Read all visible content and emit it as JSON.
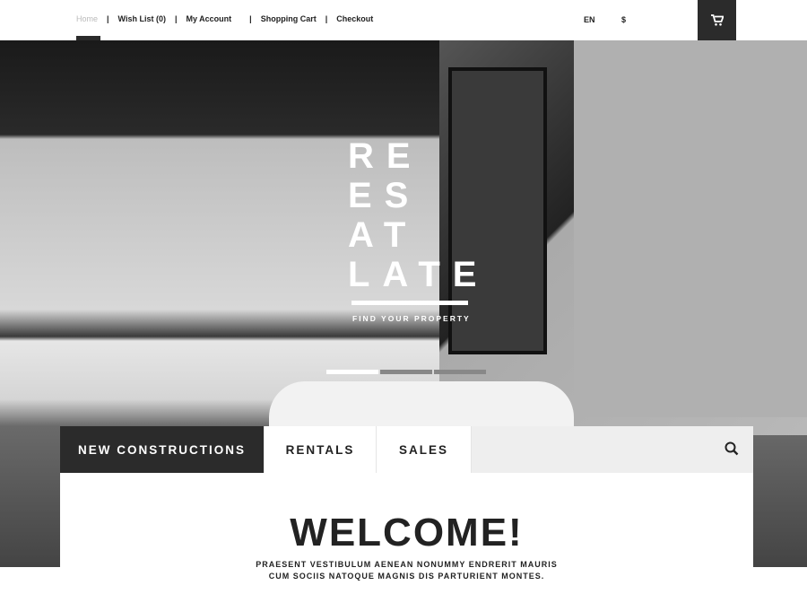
{
  "nav": {
    "items": [
      "Home",
      "Wish List (0)",
      "My Account",
      "Shopping Cart",
      "Checkout"
    ],
    "language": "EN",
    "currency": "$"
  },
  "hero": {
    "logo_lines": [
      "RE",
      "ES",
      "AT",
      "LATE"
    ],
    "tagline": "FIND YOUR PROPERTY",
    "slides": 3,
    "active_slide": 1
  },
  "tabs": [
    "NEW CONSTRUCTIONS",
    "RENTALS",
    "SALES"
  ],
  "welcome": {
    "title": "WELCOME!",
    "line1": "PRAESENT VESTIBULUM AENEAN NONUMMY ENDRERIT MAURIS",
    "line2": "CUM SOCIIS NATOQUE MAGNIS DIS PARTURIENT MONTES."
  },
  "icons": {
    "cart": "cart-icon",
    "search": "search-icon"
  }
}
